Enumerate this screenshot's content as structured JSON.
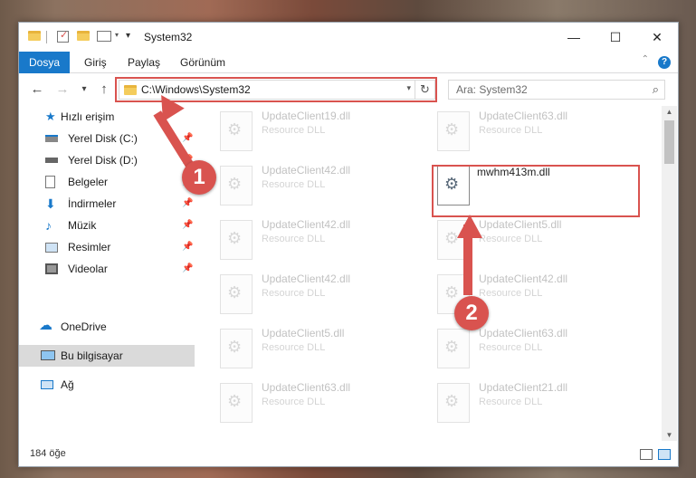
{
  "window": {
    "title": "System32",
    "minimize": "—",
    "maximize": "☐",
    "close": "✕"
  },
  "ribbon": {
    "file_tab": "Dosya",
    "tabs": [
      "Giriş",
      "Paylaş",
      "Görünüm"
    ],
    "help": "?",
    "collapse": "⌃"
  },
  "nav": {
    "back": "←",
    "forward": "→",
    "recent": "▾",
    "up": "↑",
    "address": "C:\\Windows\\System32",
    "address_dropdown": "▾",
    "refresh": "↻",
    "search_placeholder": "Ara: System32",
    "search_icon": "⌕"
  },
  "sidebar": {
    "items": [
      {
        "label": "Hızlı erişim",
        "icon": "star-icon"
      },
      {
        "label": "Yerel Disk (C:)",
        "icon": "drive-icon"
      },
      {
        "label": "Yerel Disk (D:)",
        "icon": "drive-icon"
      },
      {
        "label": "Belgeler",
        "icon": "documents-icon"
      },
      {
        "label": "İndirmeler",
        "icon": "download-icon"
      },
      {
        "label": "Müzik",
        "icon": "music-icon"
      },
      {
        "label": "Resimler",
        "icon": "pictures-icon"
      },
      {
        "label": "Videolar",
        "icon": "videos-icon"
      },
      {
        "label": "OneDrive",
        "icon": "cloud-icon"
      },
      {
        "label": "Bu bilgisayar",
        "icon": "computer-icon"
      },
      {
        "label": "Ağ",
        "icon": "network-icon"
      }
    ],
    "pin": "📌"
  },
  "files": {
    "type": "Resource DLL",
    "left": [
      "UpdateClient19.dll",
      "UpdateClient42.dll",
      "UpdateClient42.dll",
      "UpdateClient42.dll",
      "UpdateClient5.dll",
      "UpdateClient63.dll"
    ],
    "right": [
      "UpdateClient63.dll",
      "mwhm413m.dll",
      "UpdateClient5.dll",
      "UpdateClient42.dll",
      "UpdateClient63.dll",
      "UpdateClient21.dll"
    ],
    "highlighted": "mwhm413m.dll"
  },
  "status": {
    "count": "184 öğe"
  },
  "callouts": {
    "step1": "1",
    "step2": "2",
    "color": "#d9534f"
  }
}
